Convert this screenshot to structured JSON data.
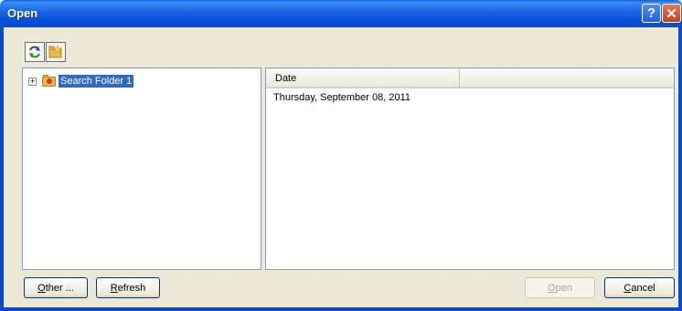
{
  "window": {
    "title": "Open",
    "help_glyph": "?",
    "close_glyph": "✕"
  },
  "toolbar": {
    "refresh_icon": "refresh-icon",
    "new_folder_icon": "new-folder-icon"
  },
  "tree": {
    "items": [
      {
        "label": "Search Folder 1",
        "expander": "+",
        "selected": true
      }
    ]
  },
  "list": {
    "columns": [
      "Date"
    ],
    "rows": [
      "Thursday, September 08, 2011"
    ]
  },
  "buttons": {
    "other_first": "O",
    "other_rest": "ther ...",
    "refresh_first": "R",
    "refresh_rest": "efresh",
    "open_first": "O",
    "open_rest": "pen",
    "cancel_first": "C",
    "cancel_rest": "ancel"
  },
  "colors": {
    "titlebar": "#0a52d6",
    "selection": "#316ac5",
    "dialog_bg": "#ece9d8"
  }
}
